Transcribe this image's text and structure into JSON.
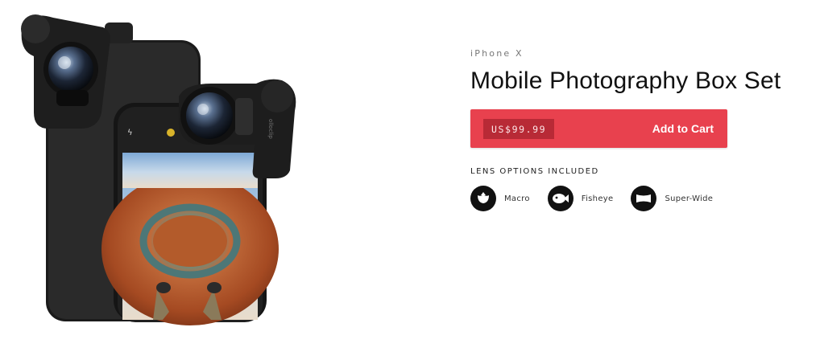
{
  "product": {
    "model": "iPhone X",
    "title": "Mobile Photography Box Set",
    "price": "US$99.99",
    "cart_label": "Add to Cart"
  },
  "options": {
    "heading": "LENS OPTIONS INCLUDED",
    "items": [
      {
        "label": "Macro",
        "icon": "macro-flower-icon"
      },
      {
        "label": "Fisheye",
        "icon": "fisheye-fish-icon"
      },
      {
        "label": "Super-Wide",
        "icon": "super-wide-icon"
      }
    ]
  },
  "hero": {
    "lens_brand": "olloclip"
  },
  "colors": {
    "accent": "#e8414e",
    "price_badge": "#b82a36",
    "icon_bg": "#111111"
  }
}
